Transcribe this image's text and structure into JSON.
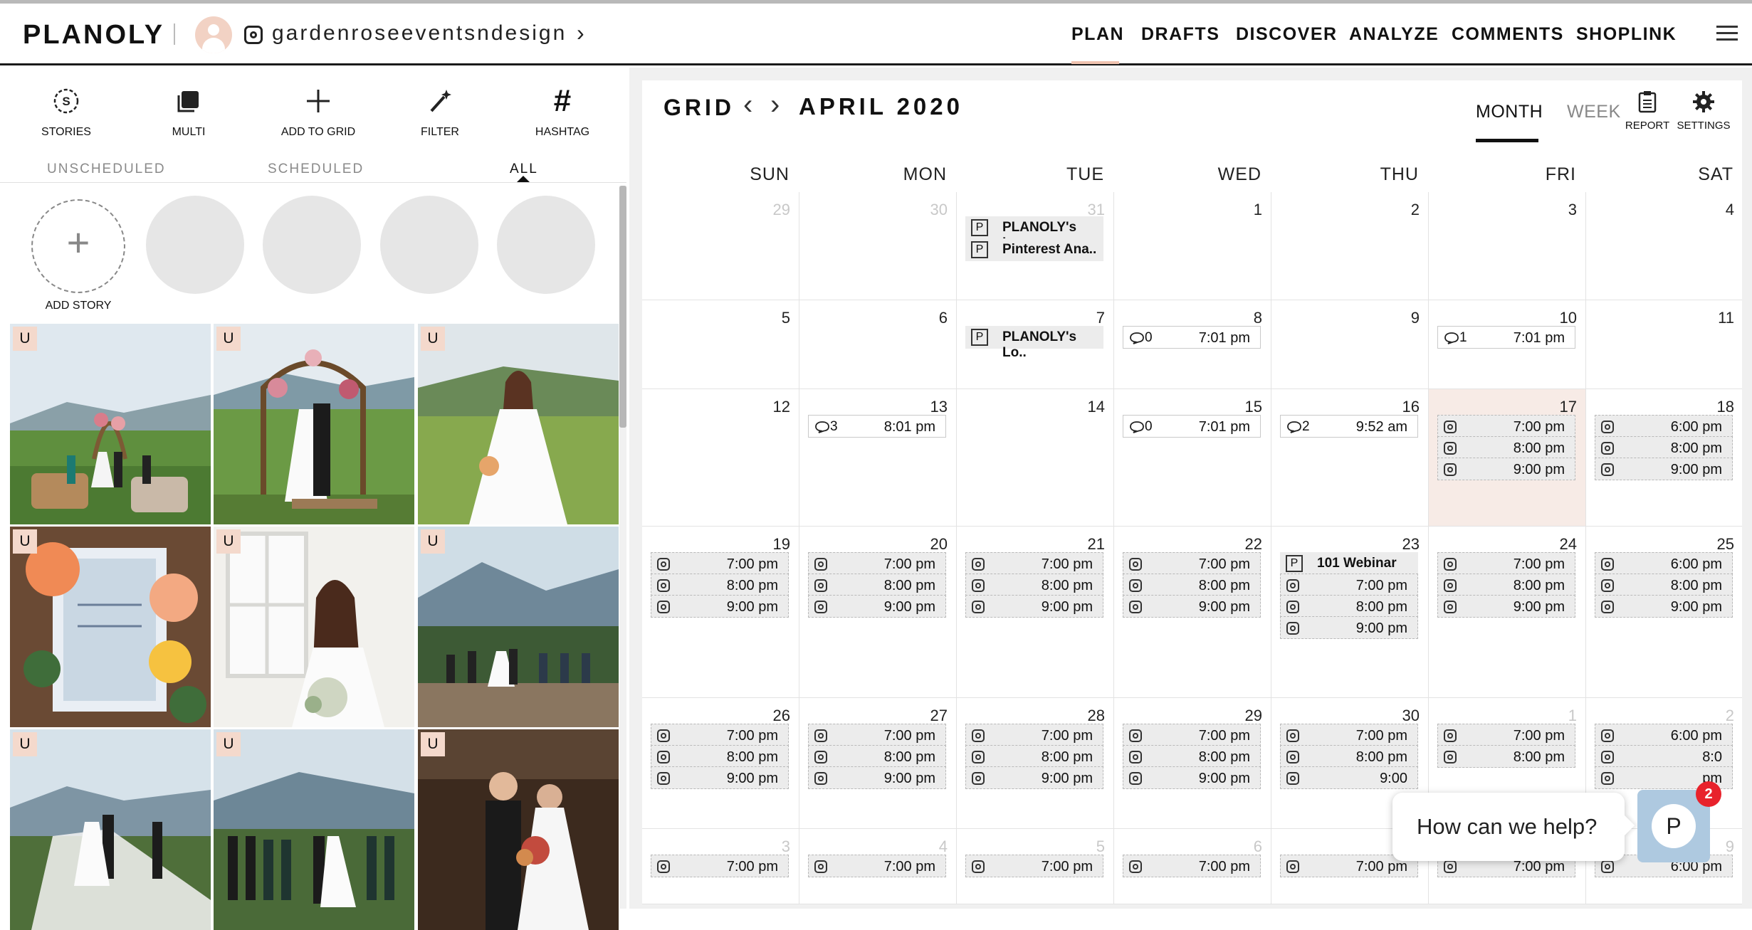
{
  "app": {
    "logo": "PLANOLY",
    "account": "gardenroseeventsndesign"
  },
  "nav": {
    "items": [
      "PLAN",
      "DRAFTS",
      "DISCOVER",
      "ANALYZE",
      "COMMENTS",
      "SHOPLINK"
    ],
    "active": "PLAN"
  },
  "toolbar": {
    "stories": "STORIES",
    "multi": "MULTI",
    "add_to_grid": "ADD TO GRID",
    "filter": "FILTER",
    "hashtag": "HASHTAG"
  },
  "tabs": {
    "unscheduled": "UNSCHEDULED",
    "scheduled": "SCHEDULED",
    "all": "ALL",
    "active": "ALL"
  },
  "stories": {
    "add_label": "ADD STORY"
  },
  "grid": {
    "badge": "U",
    "photos": [
      "ceremony-in-field",
      "couple-under-arch",
      "bride-in-field",
      "invitation-with-roses",
      "bride-by-window",
      "ceremony-on-mountain",
      "couple-veil-mountains",
      "bridal-party-mountains",
      "father-walking-bride"
    ]
  },
  "calendar": {
    "grid_label": "GRID",
    "month_label": "APRIL 2020",
    "views": {
      "month": "MONTH",
      "week": "WEEK",
      "active": "MONTH"
    },
    "report_label": "REPORT",
    "settings_label": "SETTINGS",
    "days": [
      "SUN",
      "MON",
      "TUE",
      "WED",
      "THU",
      "FRI",
      "SAT"
    ],
    "weeks": [
      [
        {
          "d": "29",
          "dim": true,
          "events": []
        },
        {
          "d": "30",
          "dim": true,
          "events": []
        },
        {
          "d": "31",
          "dim": true,
          "events": [
            {
              "type": "pin",
              "text": "PLANOLY's Lo.."
            },
            {
              "type": "pin",
              "text": "Pinterest Ana.."
            }
          ]
        },
        {
          "d": "1",
          "events": []
        },
        {
          "d": "2",
          "events": []
        },
        {
          "d": "3",
          "events": []
        },
        {
          "d": "4",
          "events": []
        }
      ],
      [
        {
          "d": "5",
          "events": []
        },
        {
          "d": "6",
          "events": []
        },
        {
          "d": "7",
          "events": [
            {
              "type": "pin",
              "text": "PLANOLY's Lo.."
            }
          ]
        },
        {
          "d": "8",
          "events": [
            {
              "type": "comment",
              "count": "0",
              "time": "7:01 pm"
            }
          ]
        },
        {
          "d": "9",
          "events": []
        },
        {
          "d": "10",
          "events": [
            {
              "type": "comment",
              "count": "1",
              "time": "7:01 pm"
            }
          ]
        },
        {
          "d": "11",
          "events": []
        }
      ],
      [
        {
          "d": "12",
          "events": []
        },
        {
          "d": "13",
          "events": [
            {
              "type": "comment",
              "count": "3",
              "time": "8:01 pm"
            }
          ]
        },
        {
          "d": "14",
          "events": []
        },
        {
          "d": "15",
          "events": [
            {
              "type": "comment",
              "count": "0",
              "time": "7:01 pm"
            }
          ]
        },
        {
          "d": "16",
          "events": [
            {
              "type": "comment",
              "count": "2",
              "time": "9:52 am"
            }
          ]
        },
        {
          "d": "17",
          "today": true,
          "events": [
            {
              "type": "ig",
              "time": "7:00 pm"
            },
            {
              "type": "ig",
              "time": "8:00 pm"
            },
            {
              "type": "ig",
              "time": "9:00 pm"
            }
          ]
        },
        {
          "d": "18",
          "events": [
            {
              "type": "ig",
              "time": "6:00 pm"
            },
            {
              "type": "ig",
              "time": "8:00 pm"
            },
            {
              "type": "ig",
              "time": "9:00 pm"
            }
          ]
        }
      ],
      [
        {
          "d": "19",
          "events": [
            {
              "type": "ig",
              "time": "7:00 pm"
            },
            {
              "type": "ig",
              "time": "8:00 pm"
            },
            {
              "type": "ig",
              "time": "9:00 pm"
            }
          ]
        },
        {
          "d": "20",
          "events": [
            {
              "type": "ig",
              "time": "7:00 pm"
            },
            {
              "type": "ig",
              "time": "8:00 pm"
            },
            {
              "type": "ig",
              "time": "9:00 pm"
            }
          ]
        },
        {
          "d": "21",
          "events": [
            {
              "type": "ig",
              "time": "7:00 pm"
            },
            {
              "type": "ig",
              "time": "8:00 pm"
            },
            {
              "type": "ig",
              "time": "9:00 pm"
            }
          ]
        },
        {
          "d": "22",
          "events": [
            {
              "type": "ig",
              "time": "7:00 pm"
            },
            {
              "type": "ig",
              "time": "8:00 pm"
            },
            {
              "type": "ig",
              "time": "9:00 pm"
            }
          ]
        },
        {
          "d": "23",
          "events": [
            {
              "type": "pin",
              "text": "101 Webinar"
            },
            {
              "type": "ig",
              "time": "7:00 pm"
            },
            {
              "type": "ig",
              "time": "8:00 pm"
            },
            {
              "type": "ig",
              "time": "9:00 pm"
            }
          ]
        },
        {
          "d": "24",
          "events": [
            {
              "type": "ig",
              "time": "7:00 pm"
            },
            {
              "type": "ig",
              "time": "8:00 pm"
            },
            {
              "type": "ig",
              "time": "9:00 pm"
            }
          ]
        },
        {
          "d": "25",
          "events": [
            {
              "type": "ig",
              "time": "6:00 pm"
            },
            {
              "type": "ig",
              "time": "8:00 pm"
            },
            {
              "type": "ig",
              "time": "9:00 pm"
            }
          ]
        }
      ],
      [
        {
          "d": "26",
          "events": [
            {
              "type": "ig",
              "time": "7:00 pm"
            },
            {
              "type": "ig",
              "time": "8:00 pm"
            },
            {
              "type": "ig",
              "time": "9:00 pm"
            }
          ]
        },
        {
          "d": "27",
          "events": [
            {
              "type": "ig",
              "time": "7:00 pm"
            },
            {
              "type": "ig",
              "time": "8:00 pm"
            },
            {
              "type": "ig",
              "time": "9:00 pm"
            }
          ]
        },
        {
          "d": "28",
          "events": [
            {
              "type": "ig",
              "time": "7:00 pm"
            },
            {
              "type": "ig",
              "time": "8:00 pm"
            },
            {
              "type": "ig",
              "time": "9:00 pm"
            }
          ]
        },
        {
          "d": "29",
          "events": [
            {
              "type": "ig",
              "time": "7:00 pm"
            },
            {
              "type": "ig",
              "time": "8:00 pm"
            },
            {
              "type": "ig",
              "time": "9:00 pm"
            }
          ]
        },
        {
          "d": "30",
          "events": [
            {
              "type": "ig",
              "time": "7:00 pm"
            },
            {
              "type": "ig",
              "time": "8:00 pm"
            },
            {
              "type": "ig",
              "time": "9:00"
            }
          ]
        },
        {
          "d": "1",
          "dim": true,
          "events": [
            {
              "type": "ig",
              "time": "7:00 pm"
            },
            {
              "type": "ig",
              "time": "8:00 pm"
            }
          ]
        },
        {
          "d": "2",
          "dim": true,
          "events": [
            {
              "type": "ig",
              "time": "6:00 pm"
            },
            {
              "type": "ig",
              "time": "8:0"
            },
            {
              "type": "ig",
              "time": "pm"
            }
          ]
        }
      ],
      [
        {
          "d": "3",
          "dim": true,
          "events": [
            {
              "type": "ig",
              "time": "7:00 pm"
            }
          ]
        },
        {
          "d": "4",
          "dim": true,
          "events": [
            {
              "type": "ig",
              "time": "7:00 pm"
            }
          ]
        },
        {
          "d": "5",
          "dim": true,
          "events": [
            {
              "type": "ig",
              "time": "7:00 pm"
            }
          ]
        },
        {
          "d": "6",
          "dim": true,
          "events": [
            {
              "type": "ig",
              "time": "7:00 pm"
            }
          ]
        },
        {
          "d": "7",
          "dim": true,
          "events": [
            {
              "type": "ig",
              "time": "7:00 pm"
            }
          ]
        },
        {
          "d": "8",
          "dim": true,
          "events": [
            {
              "type": "ig",
              "time": "7:00 pm"
            }
          ]
        },
        {
          "d": "9",
          "dim": true,
          "events": [
            {
              "type": "ig",
              "time": "6:00 pm"
            }
          ]
        }
      ]
    ]
  },
  "chat": {
    "prompt": "How can we help?",
    "button_letter": "P",
    "badge_count": "2"
  }
}
